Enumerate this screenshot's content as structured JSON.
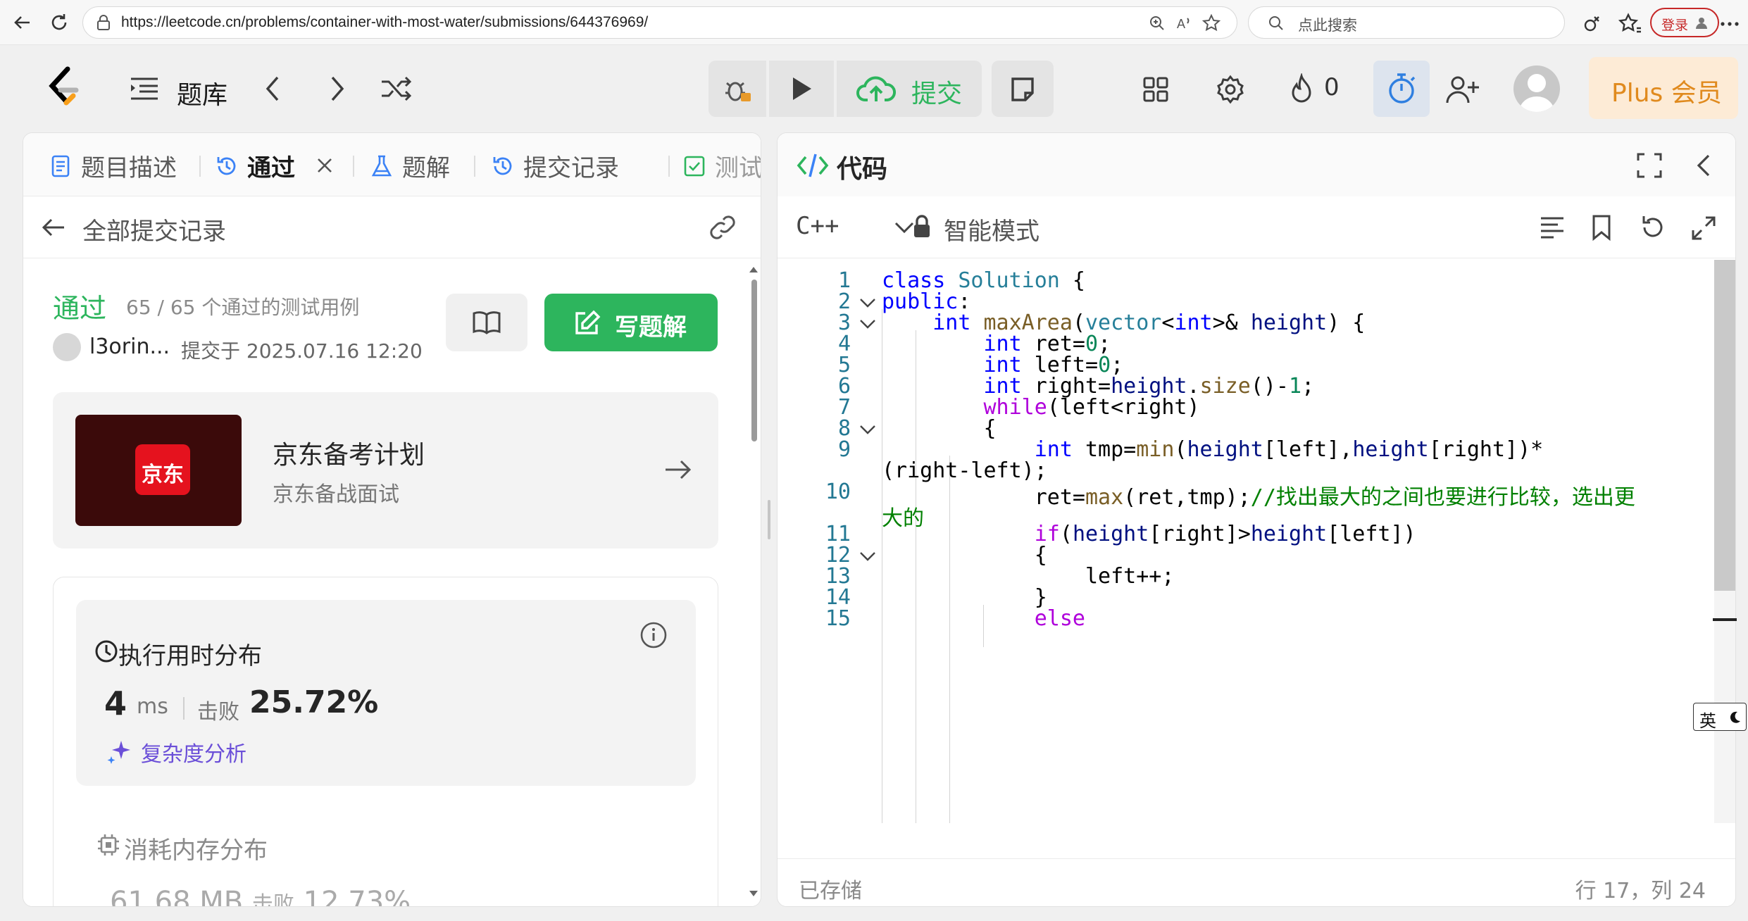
{
  "browser": {
    "url": "https://leetcode.cn/problems/container-with-most-water/submissions/644376969/",
    "search_placeholder": "点此搜索",
    "login_label": "登录"
  },
  "header": {
    "problem_list_label": "题库",
    "submit_label": "提交",
    "streak_count": "0",
    "plus_label": "Plus 会员"
  },
  "left": {
    "tabs": [
      {
        "label": "题目描述"
      },
      {
        "label": "通过"
      },
      {
        "label": "题解"
      },
      {
        "label": "提交记录"
      },
      {
        "label": "测试"
      }
    ],
    "back_label": "全部提交记录",
    "status": "通过",
    "testcases": "65 / 65 个通过的测试用例",
    "username": "l3orin...",
    "submitted_at": "提交于 2025.07.16 12:20",
    "write_solution_label": "写题解",
    "promo": {
      "logo_text": "京东",
      "title": "京东备考计划",
      "subtitle": "京东备战面试"
    },
    "runtime": {
      "title": "执行用时分布",
      "value": "4",
      "unit": "ms",
      "beats_label": "击败",
      "beats_value": "25.72%",
      "complexity_label": "复杂度分析"
    },
    "memory": {
      "title": "消耗内存分布",
      "value": "61.68 MB",
      "beats_label": "击败",
      "beats_value": "12.73%"
    }
  },
  "right": {
    "title": "代码",
    "language": "C++",
    "mode_label": "智能模式",
    "saved_label": "已存储",
    "cursor_position": "行 17，列 24",
    "ime_label": "英"
  },
  "code_lines": [
    {
      "n": "1"
    },
    {
      "n": "2"
    },
    {
      "n": "3"
    },
    {
      "n": "4"
    },
    {
      "n": "5"
    },
    {
      "n": "6"
    },
    {
      "n": "7"
    },
    {
      "n": "8"
    },
    {
      "n": "9"
    },
    {
      "n": ""
    },
    {
      "n": "10"
    },
    {
      "n": ""
    },
    {
      "n": "11"
    },
    {
      "n": "12"
    },
    {
      "n": "13"
    },
    {
      "n": "14"
    },
    {
      "n": "15"
    }
  ],
  "colors": {
    "accent_green": "#2db55d",
    "plus_orange": "#e08a1e",
    "complexity_purple": "#6b4fd8"
  }
}
